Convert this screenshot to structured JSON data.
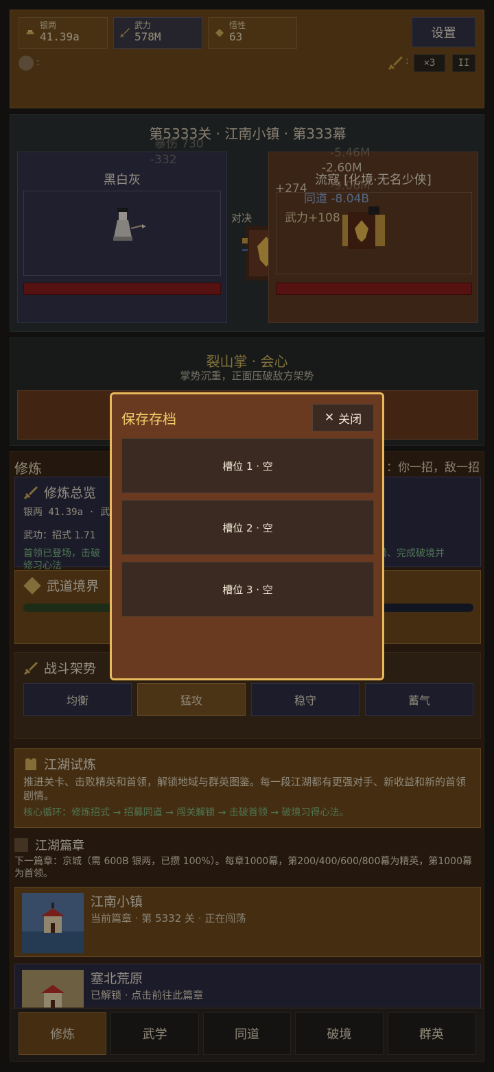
{
  "resources": [
    {
      "label": "银两",
      "value": "41.39a",
      "icon": "silver-ingot-icon"
    },
    {
      "label": "武力",
      "value": "578M",
      "icon": "sword-icon"
    },
    {
      "label": "悟性",
      "value": "63",
      "icon": "diamond-icon"
    }
  ],
  "settings_label": "设置",
  "gear_text": ":",
  "speed_colon": ":",
  "speed_label": "×3",
  "pause_label": "II",
  "battle": {
    "stage_title": "第5333关 · 江南小镇 · 第333幕",
    "player_name": "黑白灰",
    "enemy_name": "流寇 [化境·无名少侠]",
    "duel_label": "对决",
    "floats": {
      "f1": "暴伤 730",
      "f2": "-332",
      "f3": "-5.46M",
      "f4": "-2.60M",
      "f5": "+274",
      "f6": "-9.06M",
      "f7": "同道 -8.04B",
      "f8": "武力+108"
    }
  },
  "skill": {
    "name": "裂山掌 · 会心",
    "desc": "掌势沉重，正面压破敌方架势"
  },
  "panel": {
    "title": "修炼",
    "hint": "：你一招，敌一招",
    "overview_title": "修炼总览",
    "overview_line1": "银两 41.39a · 武",
    "overview_line2": "武功：招式 1.71",
    "overview_line3a": "首领已登场，击破",
    "overview_line3b": "谱、完成破境并",
    "overview_line3c": "修习心法",
    "realm_title": "武道境界",
    "realm_progress": 0.2,
    "stance_title": "战斗架势",
    "stances": [
      "均衡",
      "猛攻",
      "稳守",
      "蓄气"
    ],
    "stance_selected": 1,
    "trial_title": "江湖试炼",
    "trial_desc": "推进关卡、击败精英和首领，解锁地域与群英图鉴。每一段江湖都有更强对手、新收益和新的首领剧情。",
    "trial_loop": "核心循环：修炼招式 → 招募同道 → 闯关解锁 → 击破首领 → 破境习得心法。",
    "chapters_title": "江湖篇章",
    "chapters_next": "下一篇章：京城（需 600B 银两，已攒 100%）。每章1000幕，第200/400/600/800幕为精英，第1000幕为首领。",
    "chapters": [
      {
        "name": "江南小镇",
        "sub": "当前篇章 · 第 5332 关 · 正在闯荡"
      },
      {
        "name": "塞北荒原",
        "sub": "已解锁 · 点击前往此篇章"
      }
    ]
  },
  "nav": [
    "修炼",
    "武学",
    "同道",
    "破境",
    "群英"
  ],
  "nav_selected": 0,
  "modal": {
    "title": "保存存档",
    "close_label": "关闭",
    "slots": [
      "槽位 1 · 空",
      "槽位 2 · 空",
      "槽位 3 · 空"
    ]
  }
}
